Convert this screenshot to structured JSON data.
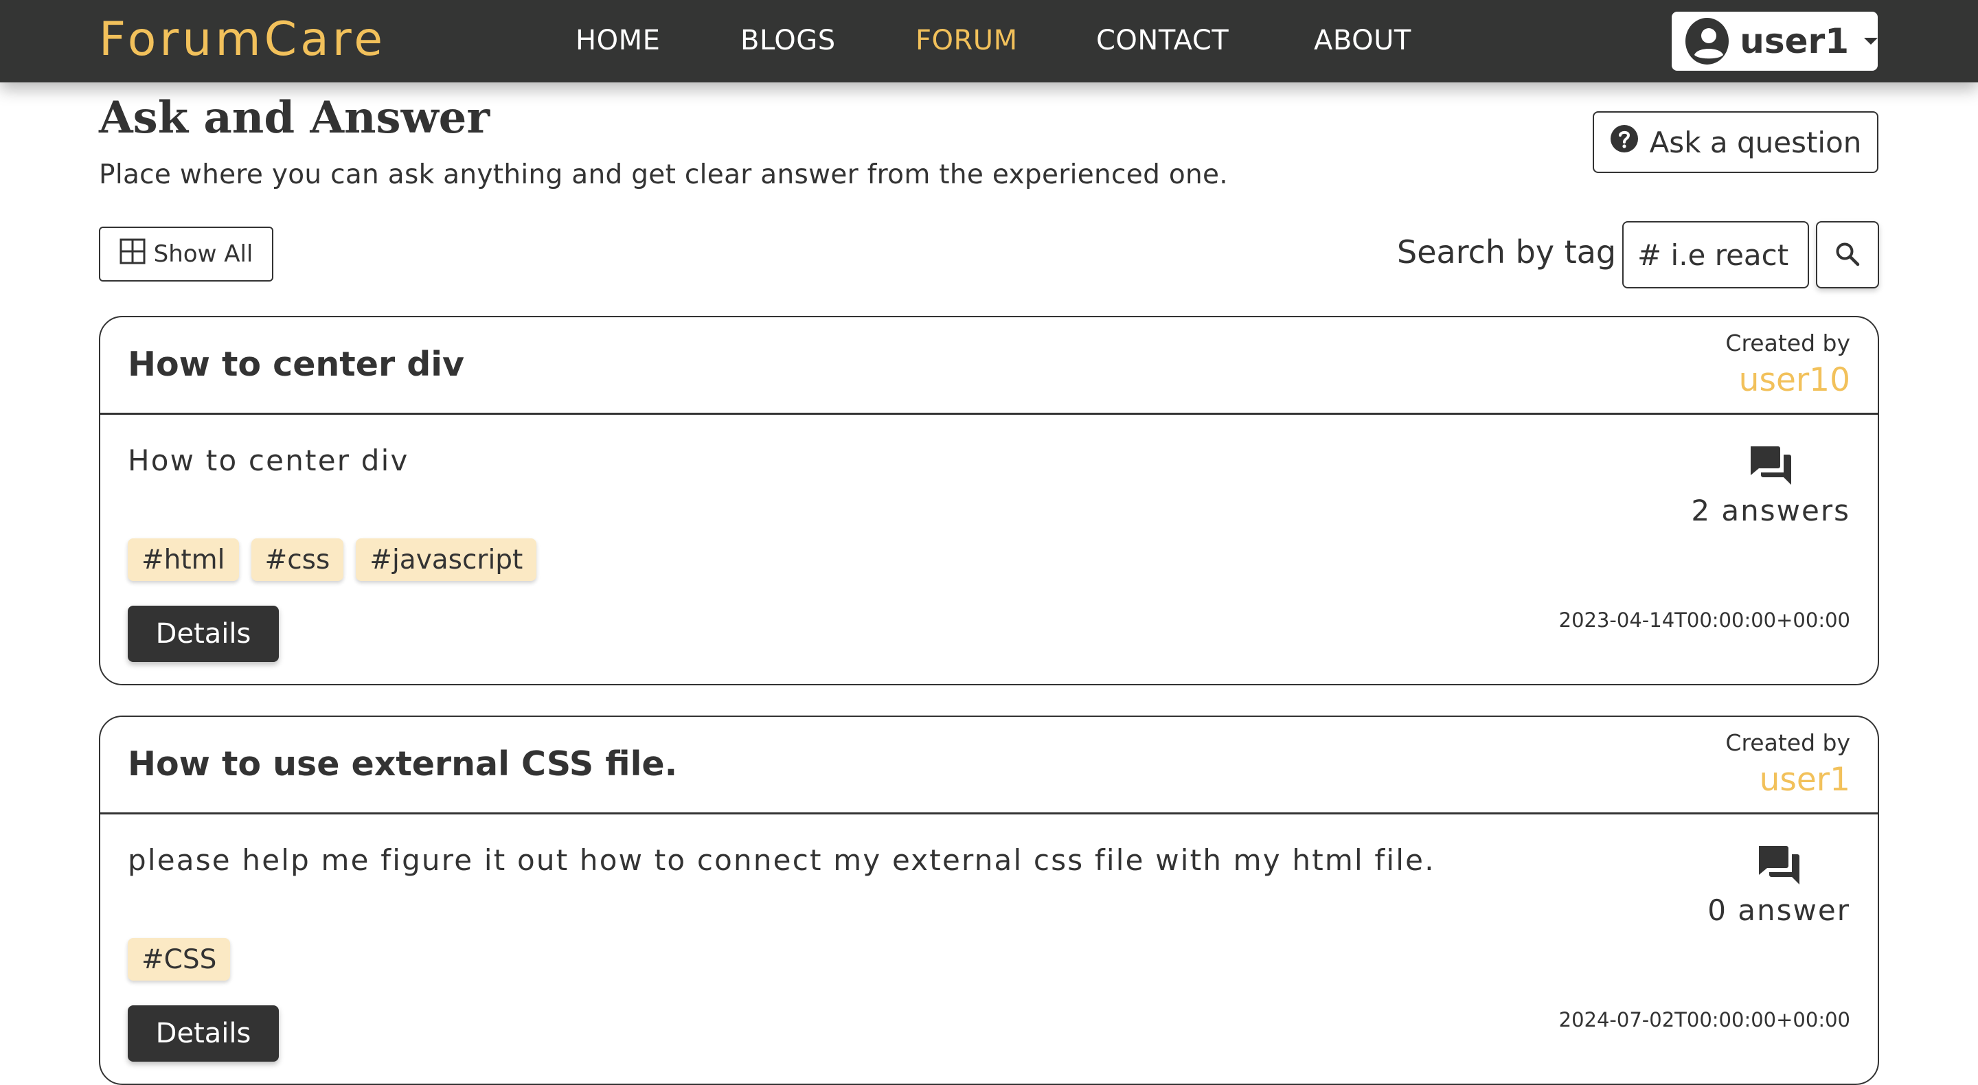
{
  "navbar": {
    "brand": "ForumCare",
    "links": [
      {
        "label": "HOME",
        "active": false
      },
      {
        "label": "BLOGS",
        "active": false
      },
      {
        "label": "FORUM",
        "active": true
      },
      {
        "label": "CONTACT",
        "active": false
      },
      {
        "label": "ABOUT",
        "active": false
      }
    ],
    "user": {
      "name": "user1",
      "icon": "account-circle-icon",
      "dropdown_icon": "caret-down-icon"
    }
  },
  "page": {
    "title": "Ask and Answer",
    "subtitle": "Place where you can ask anything and get clear answer from the experienced one.",
    "ask_button": {
      "label": "Ask a question",
      "icon": "help-circle-icon"
    },
    "show_all": {
      "label": "Show All",
      "icon": "grid-icon"
    },
    "search": {
      "label": "Search by tag",
      "placeholder": "# i.e react",
      "button_icon": "search-icon"
    }
  },
  "questions": [
    {
      "title": "How to center div",
      "created_by_label": "Created by",
      "author": "user10",
      "description": "How to center div",
      "answers_label": "2 answers",
      "answers_icon": "forum-icon",
      "tags": [
        "#html",
        "#css",
        "#javascript"
      ],
      "details_label": "Details",
      "date": "2023-04-14T00:00:00+00:00"
    },
    {
      "title": "How to use external CSS file.",
      "created_by_label": "Created by",
      "author": "user1",
      "description": "please help me figure it out how to connect my external css file with my html file.",
      "answers_label": "0 answer",
      "answers_icon": "forum-icon",
      "tags": [
        "#CSS"
      ],
      "details_label": "Details",
      "date": "2024-07-02T00:00:00+00:00"
    }
  ],
  "colors": {
    "navbar_bg": "#343534",
    "accent": "#f2c15b",
    "text": "#333333",
    "tag_bg": "#fbe9c4",
    "button_bg": "#333333"
  }
}
